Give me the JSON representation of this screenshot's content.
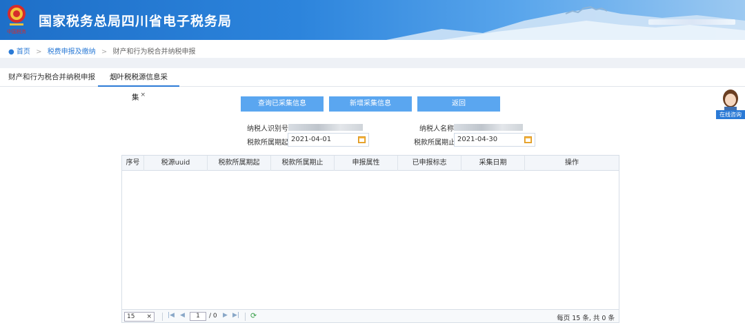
{
  "header": {
    "title": "国家税务总局四川省电子税务局",
    "emblem_text": "中国税务"
  },
  "breadcrumb": {
    "home": "首页",
    "level1": "税费申报及缴纳",
    "level2": "财产和行为税合并纳税申报"
  },
  "tabs": [
    {
      "label": "财产和行为税合并纳税申报"
    },
    {
      "label": "烟叶税税源信息采集",
      "close": "×"
    }
  ],
  "actions": {
    "query_label": "查询已采集信息",
    "add_label": "新增采集信息",
    "back_label": "返回"
  },
  "form": {
    "taxpayer_id_label": "纳税人识别号",
    "taxpayer_name_label": "纳税人名称",
    "period_start_label": "税款所属期起",
    "period_start_value": "2021-04-01",
    "period_end_label": "税款所属期止",
    "period_end_value": "2021-04-30"
  },
  "table": {
    "columns": [
      "序号",
      "税源uuid",
      "税款所属期起",
      "税款所属期止",
      "申报属性",
      "已申报标志",
      "采集日期",
      "操作"
    ],
    "rows": []
  },
  "pager": {
    "page_size": "15",
    "page_size_clear": "×",
    "current_page": "1",
    "total_pages": "/ 0",
    "summary": "每页 15 条, 共 0 条"
  },
  "assistant": {
    "label": "在线咨询"
  },
  "colors": {
    "header_blue": "#1e6fc8",
    "button_blue": "#5aa6f0",
    "link_blue": "#2a7ad6"
  }
}
